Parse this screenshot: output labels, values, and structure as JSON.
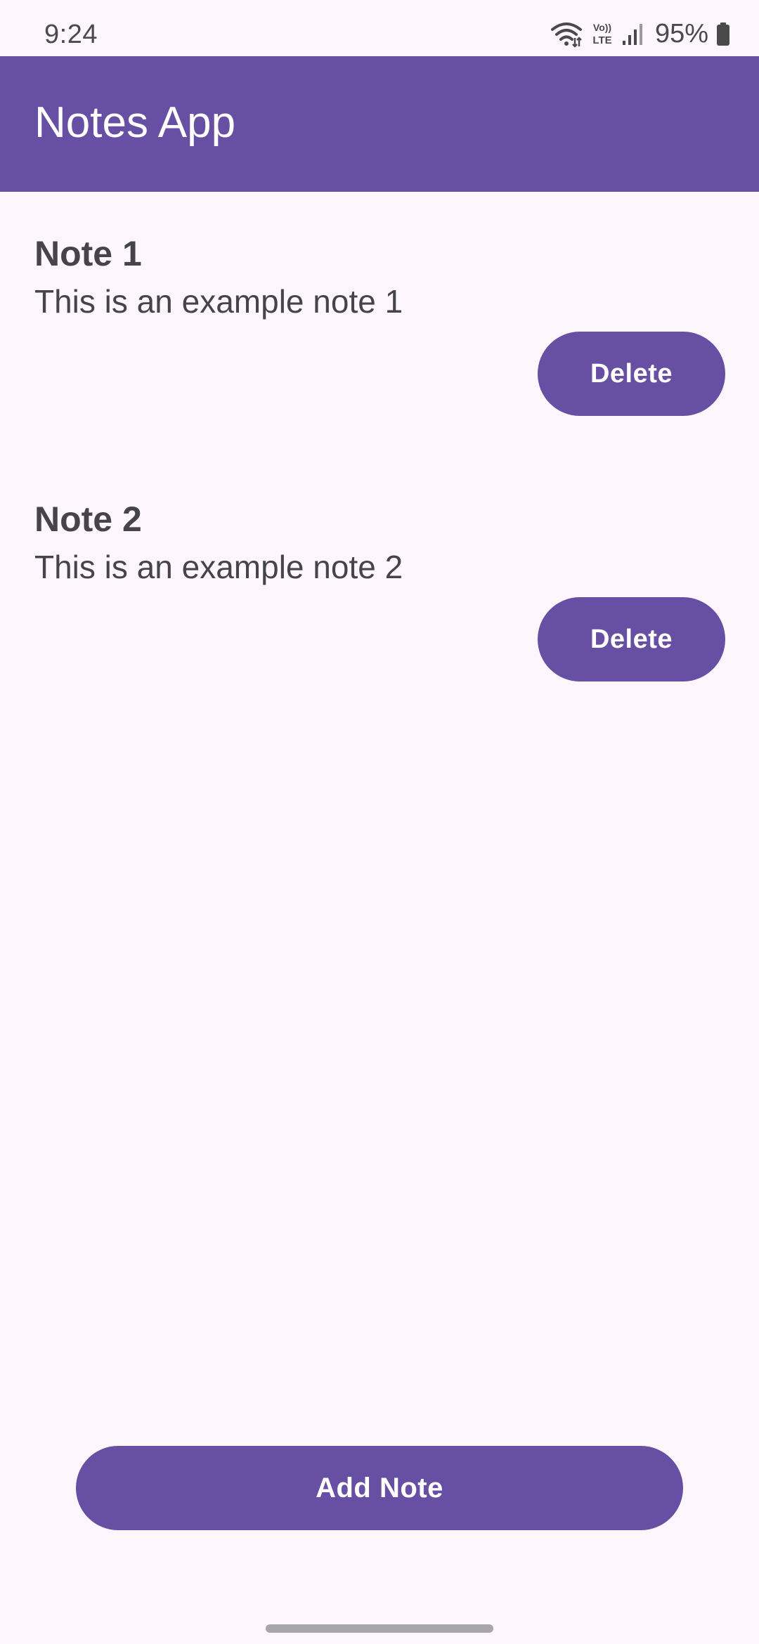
{
  "status_bar": {
    "time": "9:24",
    "network_label": "Vo)) LTE",
    "battery_percent": "95%",
    "icons": [
      "wifi-icon",
      "volte-icon",
      "signal-icon",
      "battery-icon"
    ]
  },
  "app_bar": {
    "title": "Notes App"
  },
  "notes": [
    {
      "title": "Note 1",
      "content": "This is an example note 1",
      "delete_label": "Delete"
    },
    {
      "title": "Note 2",
      "content": "This is an example note 2",
      "delete_label": "Delete"
    }
  ],
  "actions": {
    "add_note_label": "Add Note"
  },
  "colors": {
    "primary": "#6750a4",
    "background": "#fdf7fd",
    "on_primary": "#ffffff",
    "text": "#46444a"
  }
}
